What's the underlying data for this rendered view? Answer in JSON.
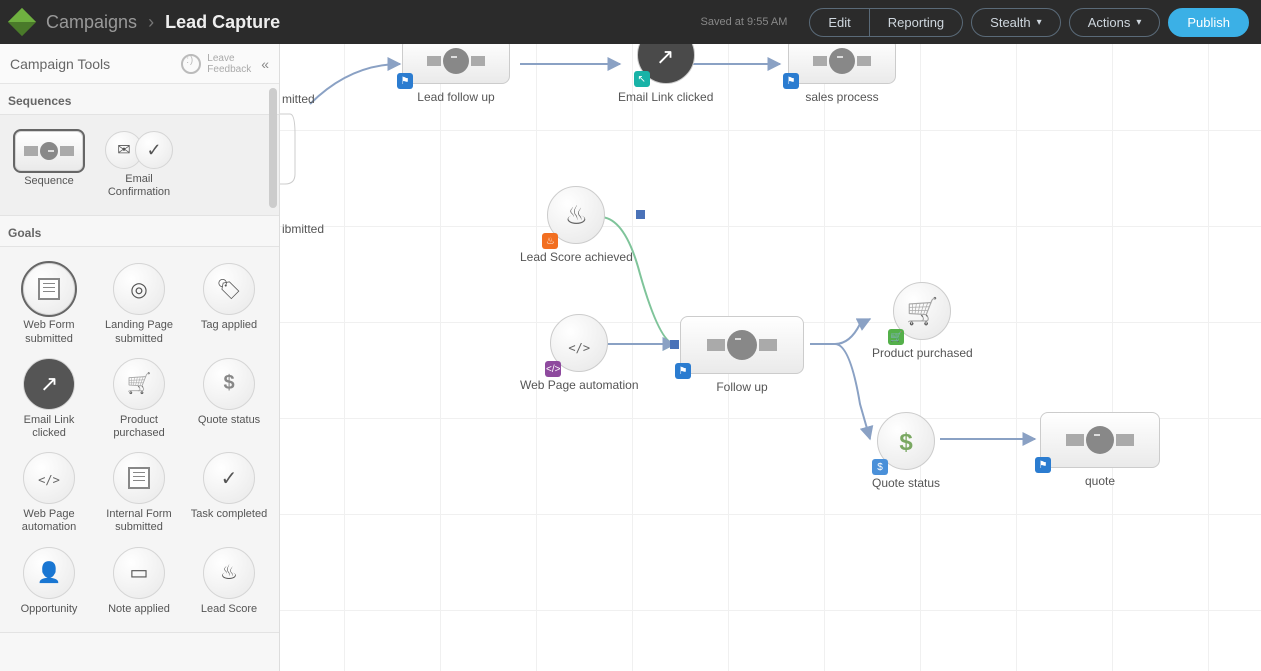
{
  "header": {
    "breadcrumb_root": "Campaigns",
    "breadcrumb_sep": "›",
    "breadcrumb_current": "Lead Capture",
    "saved_text": "Saved at 9:55 AM",
    "edit": "Edit",
    "reporting": "Reporting",
    "stealth": "Stealth",
    "actions": "Actions",
    "publish": "Publish"
  },
  "sidebar": {
    "title": "Campaign Tools",
    "feedback_l1": "Leave",
    "feedback_l2": "Feedback",
    "section_sequences": "Sequences",
    "section_goals": "Goals",
    "tools_seq": [
      {
        "label": "Sequence"
      },
      {
        "label": "Email Confirmation"
      }
    ],
    "tools_goals": [
      {
        "label": "Web Form submitted"
      },
      {
        "label": "Landing Page submitted"
      },
      {
        "label": "Tag applied"
      },
      {
        "label": "Email Link clicked"
      },
      {
        "label": "Product purchased"
      },
      {
        "label": "Quote status"
      },
      {
        "label": "Web Page automation"
      },
      {
        "label": "Internal Form submitted"
      },
      {
        "label": "Task completed"
      },
      {
        "label": "Opportunity"
      },
      {
        "label": "Note applied"
      },
      {
        "label": "Lead Score"
      }
    ]
  },
  "canvas": {
    "cut1": "mitted",
    "cut2": "ibmitted",
    "nodes": {
      "lead_follow_up": "Lead follow up",
      "email_link_clicked": "Email Link clicked",
      "sales_process": "sales process",
      "lead_score_achieved": "Lead Score achieved",
      "web_page_automation": "Web Page automation",
      "follow_up": "Follow up",
      "product_purchased": "Product purchased",
      "quote_status": "Quote status",
      "quote": "quote"
    }
  }
}
